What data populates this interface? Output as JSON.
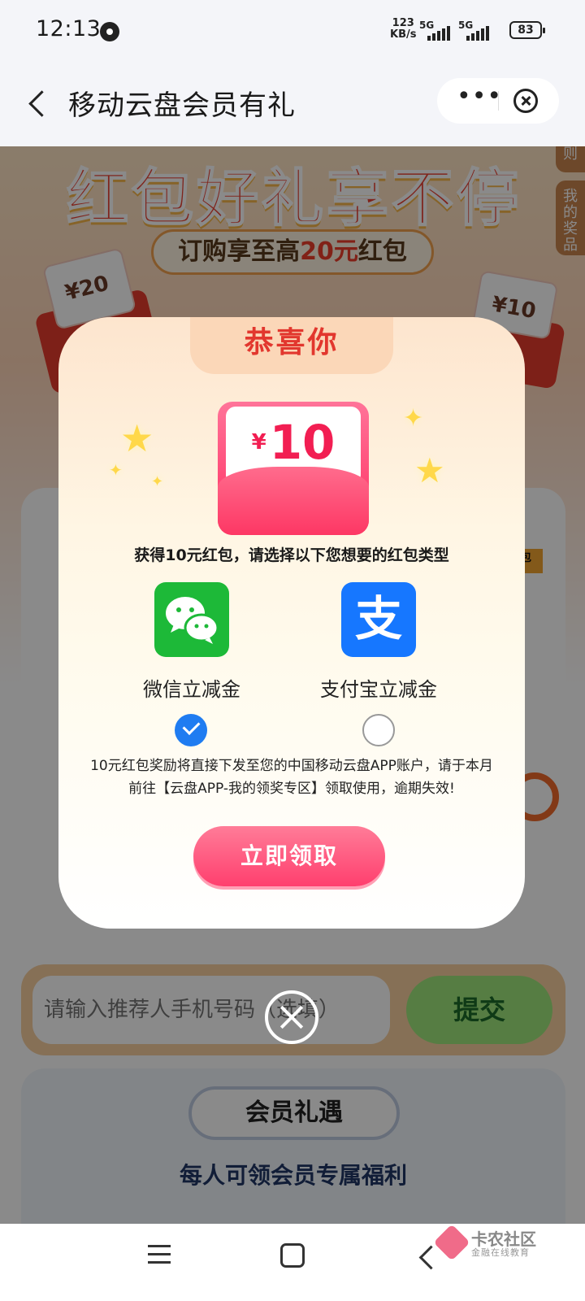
{
  "status_bar": {
    "time": "12:13",
    "net_speed_value": "123",
    "net_speed_unit": "KB/s",
    "sim1": "5G",
    "sim2": "5G",
    "battery": "83"
  },
  "nav": {
    "title": "移动云盘会员有礼",
    "more": "•••"
  },
  "hero": {
    "title": "红包好礼享不停",
    "pill_prefix": "订购享至高",
    "pill_amount": "20元",
    "pill_suffix": "红包",
    "coupon_left": "¥20",
    "coupon_right": "¥10",
    "side_tab_rules": "则",
    "side_tab_prizes": "我的奖品"
  },
  "bg_card": {
    "tag": "包"
  },
  "referral": {
    "placeholder": "请输入推荐人手机号码（选填）",
    "submit_label": "提交"
  },
  "member": {
    "pill": "会员礼遇",
    "desc": "每人可领会员专属福利"
  },
  "modal": {
    "header": "恭喜你",
    "envelope_currency": "¥",
    "envelope_amount": "10",
    "subtitle": "获得10元红包，请选择以下您想要的红包类型",
    "option_wechat": "微信立减金",
    "option_alipay": "支付宝立减金",
    "alipay_glyph": "支",
    "selected": "wechat",
    "note_line1": "10元红包奖励将直接下发至您的中国移动云盘APP账户，请于本月",
    "note_line2": "前往【云盘APP-我的领奖专区】领取使用，逾期失效!",
    "claim_button": "立即领取"
  },
  "watermark": {
    "name": "卡农社区",
    "sub": "金融在线教育"
  },
  "colors": {
    "accent_red": "#e2372e",
    "wechat_green": "#1db938",
    "alipay_blue": "#1677ff",
    "claim_pink": "#ff4f78",
    "radio_blue": "#1f7cf1"
  },
  "icons": [
    "back-icon",
    "more-icon",
    "close-icon",
    "wechat-icon",
    "alipay-icon",
    "check-icon",
    "menu-icon",
    "home-icon",
    "nav-back-icon"
  ]
}
